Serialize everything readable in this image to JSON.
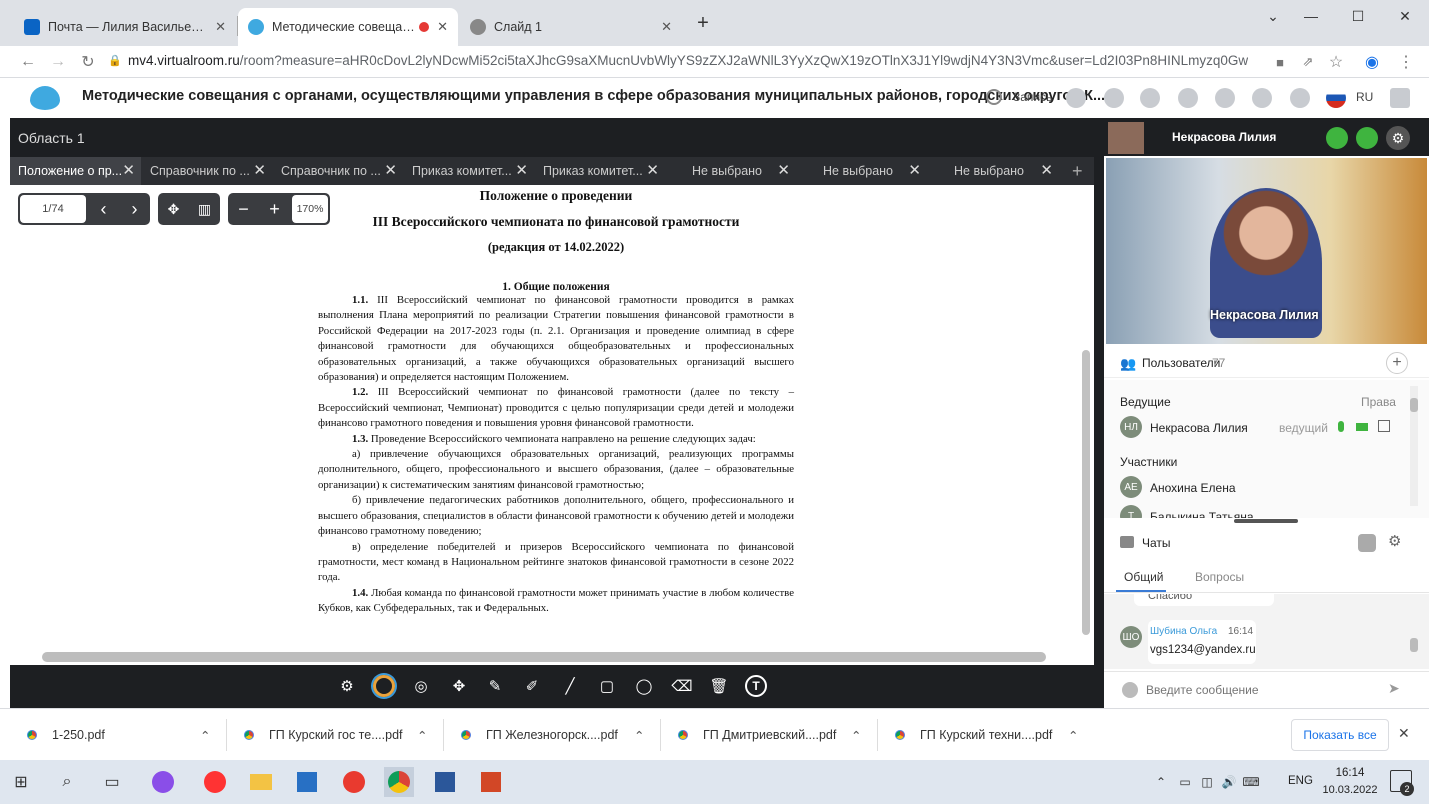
{
  "browser": {
    "tabs": [
      {
        "title": "Почта — Лилия Васильевна Не",
        "icon": "outlook-icon"
      },
      {
        "title": "Методические совещания с",
        "icon": "virtualroom-icon",
        "active": true
      },
      {
        "title": "Слайд 1",
        "icon": "globe-icon"
      }
    ],
    "new_tab": "+",
    "url_host": "mv4.virtualroom.ru",
    "url_path": "/room?measure=aHR0cDovL2lyNDcwMi52ci5taXJhcG9saXMucnUvbWlyYS9zZXJ2aWNlL3YyXzQwX19zOTlnX3J1Yl9wdjN4Y3N3Vmc&user=Ld2I03Pn8HINLmyzq0GwMA"
  },
  "app": {
    "title": "Методические совещания с органами, осуществляющими управления в сфере образования муниципальных районов, городских округов К...",
    "record_label": "Запись",
    "lang": "RU",
    "area_title": "Область 1"
  },
  "doc_tabs": [
    {
      "label": "Положение о пр...",
      "active": true
    },
    {
      "label": "Справочник по ..."
    },
    {
      "label": "Справочник по ..."
    },
    {
      "label": "Приказ комитет..."
    },
    {
      "label": "Приказ комитет..."
    },
    {
      "label": "Не выбрано"
    },
    {
      "label": "Не выбрано"
    },
    {
      "label": "Не выбрано"
    }
  ],
  "viewer": {
    "page": "1/74",
    "zoom": "170%"
  },
  "document": {
    "title1": "Положение о проведении",
    "title2": "III Всероссийского чемпионата по финансовой грамотности",
    "title3": "(редакция от 14.02.2022)",
    "section1": "1. Общие положения",
    "p1_num": "1.1.",
    "p1": "III Всероссийский чемпионат по финансовой грамотности проводится в рамках выполнения Плана мероприятий по реализации Стратегии повышения финансовой грамотности в Российской Федерации на 2017-2023 годы (п. 2.1. Организация и проведение олимпиад в сфере финансовой грамотности для обучающихся общеобразовательных и профессиональных образовательных организаций, а также обучающихся образовательных организаций высшего образования) и определяется настоящим Положением.",
    "p2_num": "1.2.",
    "p2": "III Всероссийский чемпионат по финансовой грамотности (далее по тексту – Всероссийский чемпионат, Чемпионат) проводится с целью популяризации среди детей и молодежи финансово грамотного поведения и повышения уровня финансовой грамотности.",
    "p3_num": "1.3.",
    "p3": "Проведение Всероссийского чемпионата направлено на решение следующих задач:",
    "p3a": "а) привлечение обучающихся образовательных организаций, реализующих программы дополнительного, общего, профессионального и высшего образования, (далее – образовательные организации) к систематическим занятиям финансовой грамотностью;",
    "p3b": "б) привлечение педагогических работников дополнительного, общего, профессионального и высшего образования, специалистов в области финансовой грамотности к обучению детей и молодежи финансово грамотному поведению;",
    "p3c": "в) определение победителей и призеров Всероссийского чемпионата по финансовой грамотности, мест команд в Национальном рейтинге знатоков финансовой грамотности в сезоне 2022 года.",
    "p4_num": "1.4.",
    "p4": "Любая команда по финансовой грамотности может принимать участие в любом количестве Кубков, как Субфедеральных, так и Федеральных."
  },
  "video": {
    "name_header": "Некрасова Лилия",
    "name_overlay": "Некрасова Лилия"
  },
  "users": {
    "title": "Пользователи",
    "count": "77",
    "hosts_label": "Ведущие",
    "rights_label": "Права",
    "host": {
      "initials": "НЛ",
      "name": "Некрасова Лилия",
      "role": "ведущий"
    },
    "participants_label": "Участники",
    "participants": [
      {
        "initials": "АЕ",
        "name": "Анохина Елена"
      },
      {
        "initials": "Т",
        "name": "Балыкина Татьяна"
      }
    ]
  },
  "chat": {
    "title": "Чаты",
    "tab_general": "Общий",
    "tab_questions": "Вопросы",
    "prev_message": "Спасибо",
    "message": {
      "initials": "ШО",
      "author": "Шубина Ольга",
      "time": "16:14",
      "text": "vgs1234@yandex.ru"
    },
    "input_placeholder": "Введите сообщение"
  },
  "downloads": {
    "items": [
      "1-250.pdf",
      "ГП Курский гос те....pdf",
      "ГП Железногорск....pdf",
      "ГП Дмитриевский....pdf",
      "ГП Курский техни....pdf"
    ],
    "show_all": "Показать все"
  },
  "taskbar": {
    "lang": "ENG",
    "time": "16:14",
    "date": "10.03.2022",
    "notifications": "2"
  }
}
